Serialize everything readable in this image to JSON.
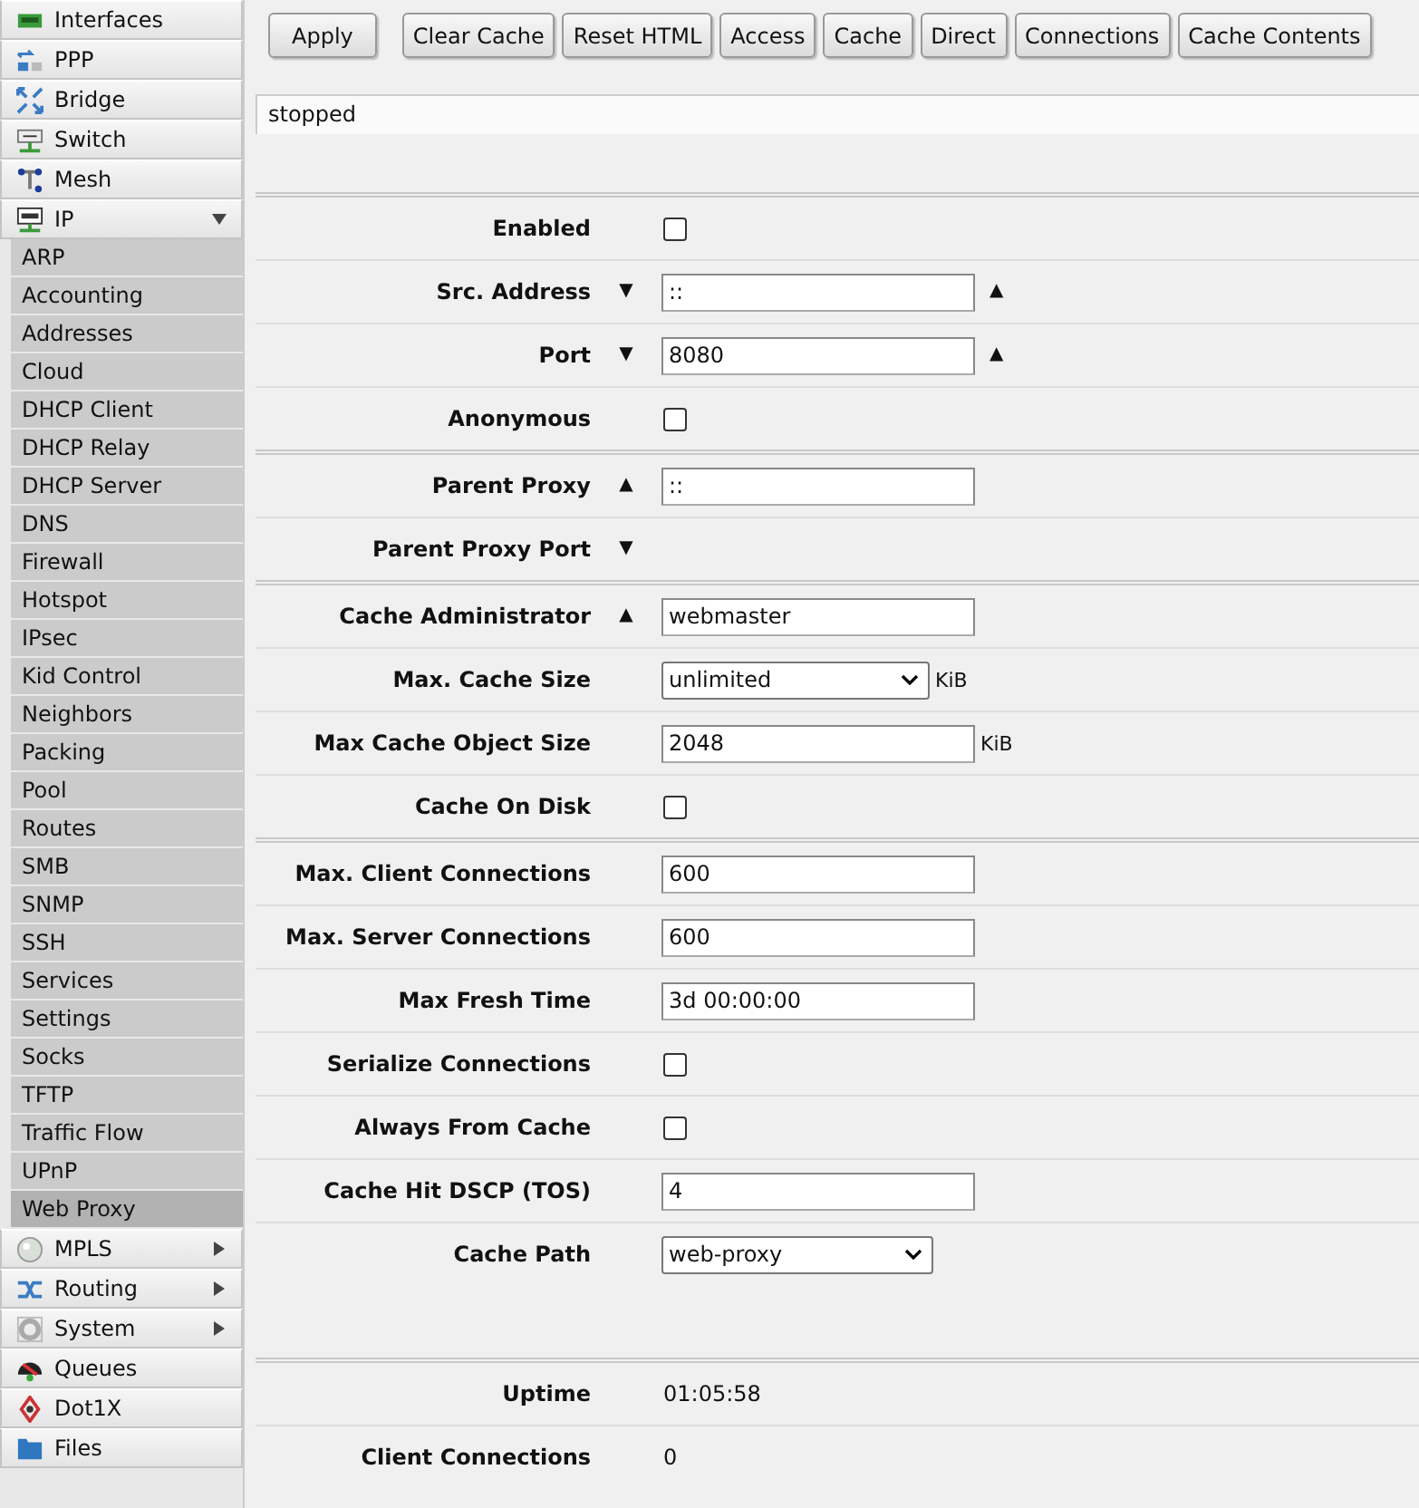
{
  "sidebar": {
    "items": [
      {
        "label": "Interfaces",
        "selected": false
      },
      {
        "label": "PPP",
        "selected": false
      },
      {
        "label": "Bridge",
        "selected": false
      },
      {
        "label": "Switch",
        "selected": false
      },
      {
        "label": "Mesh",
        "selected": false
      },
      {
        "label": "IP",
        "selected": false,
        "expanded": true,
        "children": [
          {
            "label": "ARP",
            "selected": false
          },
          {
            "label": "Accounting",
            "selected": false
          },
          {
            "label": "Addresses",
            "selected": false
          },
          {
            "label": "Cloud",
            "selected": false
          },
          {
            "label": "DHCP Client",
            "selected": false
          },
          {
            "label": "DHCP Relay",
            "selected": false
          },
          {
            "label": "DHCP Server",
            "selected": false
          },
          {
            "label": "DNS",
            "selected": false
          },
          {
            "label": "Firewall",
            "selected": false
          },
          {
            "label": "Hotspot",
            "selected": false
          },
          {
            "label": "IPsec",
            "selected": false
          },
          {
            "label": "Kid Control",
            "selected": false
          },
          {
            "label": "Neighbors",
            "selected": false
          },
          {
            "label": "Packing",
            "selected": false
          },
          {
            "label": "Pool",
            "selected": false
          },
          {
            "label": "Routes",
            "selected": false
          },
          {
            "label": "SMB",
            "selected": false
          },
          {
            "label": "SNMP",
            "selected": false
          },
          {
            "label": "SSH",
            "selected": false
          },
          {
            "label": "Services",
            "selected": false
          },
          {
            "label": "Settings",
            "selected": false
          },
          {
            "label": "Socks",
            "selected": false
          },
          {
            "label": "TFTP",
            "selected": false
          },
          {
            "label": "Traffic Flow",
            "selected": false
          },
          {
            "label": "UPnP",
            "selected": false
          },
          {
            "label": "Web Proxy",
            "selected": true
          }
        ]
      },
      {
        "label": "MPLS",
        "selected": false,
        "expanded": false
      },
      {
        "label": "Routing",
        "selected": false,
        "expanded": false
      },
      {
        "label": "System",
        "selected": false,
        "expanded": false
      },
      {
        "label": "Queues",
        "selected": false
      },
      {
        "label": "Dot1X",
        "selected": false
      },
      {
        "label": "Files",
        "selected": false
      }
    ]
  },
  "toolbar": {
    "buttons": [
      "Apply",
      "Clear Cache",
      "Reset HTML",
      "Access",
      "Cache",
      "Direct",
      "Connections",
      "Cache Contents"
    ]
  },
  "status": "stopped",
  "sections": [
    {
      "kind": "form",
      "rows": [
        {
          "label": "Enabled",
          "kind": "checkbox",
          "checked": false
        },
        {
          "label": "Src. Address",
          "kind": "input",
          "value": "::",
          "arrow_before": "▼",
          "arrow_after": "▲"
        },
        {
          "label": "Port",
          "kind": "input",
          "value": "8080",
          "arrow_before": "▼",
          "arrow_after": "▲"
        },
        {
          "label": "Anonymous",
          "kind": "checkbox",
          "checked": false
        }
      ]
    },
    {
      "kind": "form",
      "rows": [
        {
          "label": "Parent Proxy",
          "kind": "input",
          "value": "::",
          "arrow_before": "▲"
        },
        {
          "label": "Parent Proxy Port",
          "kind": "none",
          "arrow_before": "▼"
        }
      ]
    },
    {
      "kind": "form",
      "rows": [
        {
          "label": "Cache Administrator",
          "kind": "input",
          "value": "webmaster",
          "arrow_before": "▲"
        },
        {
          "label": "Max. Cache Size",
          "kind": "select",
          "value": "unlimited",
          "unit": "KiB"
        },
        {
          "label": "Max Cache Object Size",
          "kind": "input",
          "value": "2048",
          "unit": "KiB"
        },
        {
          "label": "Cache On Disk",
          "kind": "checkbox",
          "checked": false
        }
      ]
    },
    {
      "kind": "form",
      "rows": [
        {
          "label": "Max. Client Connections",
          "kind": "input",
          "value": "600"
        },
        {
          "label": "Max. Server Connections",
          "kind": "input",
          "value": "600"
        },
        {
          "label": "Max Fresh Time",
          "kind": "input",
          "value": "3d 00:00:00"
        },
        {
          "label": "Serialize Connections",
          "kind": "checkbox",
          "checked": false
        },
        {
          "label": "Always From Cache",
          "kind": "checkbox",
          "checked": false
        },
        {
          "label": "Cache Hit DSCP (TOS)",
          "kind": "input",
          "value": "4"
        },
        {
          "label": "Cache Path",
          "kind": "select",
          "value": "web-proxy"
        }
      ]
    },
    {
      "kind": "stats",
      "rows": [
        {
          "label": "Uptime",
          "kind": "text",
          "value": "01:05:58"
        },
        {
          "label": "Client Connections",
          "kind": "text",
          "value": "0"
        }
      ]
    }
  ]
}
